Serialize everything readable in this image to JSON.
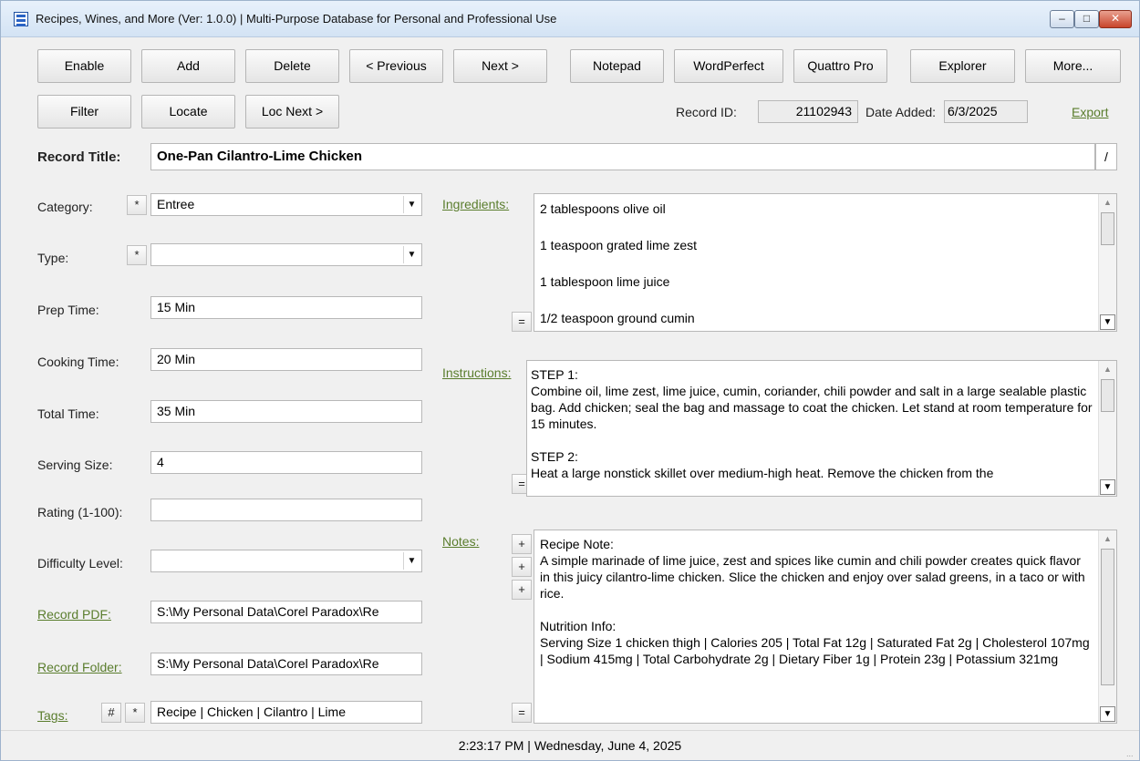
{
  "window": {
    "title": "Recipes, Wines, and More (Ver: 1.0.0)  |  Multi-Purpose Database for Personal and Professional Use",
    "controls": {
      "minimize": "–",
      "maximize": "□",
      "close": "✕"
    }
  },
  "toolbar_row1": {
    "enable": "Enable",
    "add": "Add",
    "delete": "Delete",
    "previous": "< Previous",
    "next": "Next >",
    "notepad": "Notepad",
    "wordperfect": "WordPerfect",
    "quattro_pro": "Quattro Pro",
    "explorer": "Explorer",
    "more": "More..."
  },
  "toolbar_row2": {
    "filter": "Filter",
    "locate": "Locate",
    "loc_next": "Loc Next >",
    "record_id_label": "Record ID:",
    "record_id_value": "21102943",
    "date_added_label": "Date Added:",
    "date_added_value": "6/3/2025",
    "export": "Export"
  },
  "record": {
    "title_label": "Record Title:",
    "title_value": "One-Pan Cilantro-Lime Chicken",
    "title_edit_button": "/"
  },
  "left_fields": {
    "category_label": "Category:",
    "category_star": "*",
    "category_value": "Entree",
    "type_label": "Type:",
    "type_star": "*",
    "type_value": "",
    "prep_time_label": "Prep Time:",
    "prep_time_value": "15 Min",
    "cooking_time_label": "Cooking Time:",
    "cooking_time_value": "20 Min",
    "total_time_label": "Total Time:",
    "total_time_value": "35 Min",
    "serving_size_label": "Serving Size:",
    "serving_size_value": "4",
    "rating_label": "Rating (1-100):",
    "rating_value": "",
    "difficulty_label": "Difficulty Level:",
    "difficulty_value": "",
    "record_pdf_label": "Record PDF:",
    "record_pdf_value": "S:\\My Personal Data\\Corel Paradox\\Re",
    "record_folder_label": "Record Folder:",
    "record_folder_value": "S:\\My Personal Data\\Corel Paradox\\Re",
    "tags_label": "Tags:",
    "tags_hash": "#",
    "tags_star": "*",
    "tags_value": "Recipe | Chicken | Cilantro | Lime"
  },
  "ingredients": {
    "label": "Ingredients:",
    "equals": "=",
    "text": "2 tablespoons olive oil\n\n1 teaspoon grated lime zest\n\n1 tablespoon lime juice\n\n1/2 teaspoon ground cumin"
  },
  "instructions": {
    "label": "Instructions:",
    "equals": "=",
    "text": "STEP 1:\nCombine oil, lime zest, lime juice, cumin, coriander, chili powder and salt in a large sealable plastic bag. Add chicken; seal the bag and massage to coat the chicken. Let stand at room temperature for 15 minutes.\n\nSTEP 2:\nHeat a large nonstick skillet over medium-high heat. Remove the chicken from the"
  },
  "notes": {
    "label": "Notes:",
    "plus": "+",
    "equals": "=",
    "text": "Recipe Note:\nA simple marinade of lime juice, zest and spices like cumin and chili powder creates quick flavor in this juicy cilantro-lime chicken. Slice the chicken and enjoy over salad greens, in a taco or with rice.\n\nNutrition Info:\nServing Size 1 chicken thigh | Calories 205 | Total Fat 12g | Saturated Fat 2g | Cholesterol 107mg | Sodium 415mg | Total Carbohydrate 2g | Dietary Fiber 1g | Protein 23g | Potassium 321mg"
  },
  "scroll_glyphs": {
    "up": "▲",
    "down": "▼"
  },
  "status_bar": {
    "text": "2:23:17 PM  |  Wednesday, June 4, 2025",
    "grip": "..."
  }
}
